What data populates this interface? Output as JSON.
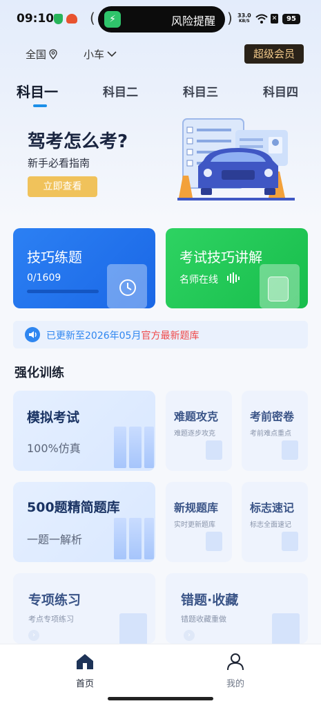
{
  "status_bar": {
    "time": "09:10",
    "island_text": "风险提醒",
    "net_speed_value": "33.0",
    "net_speed_unit": "KB/S",
    "battery": "95"
  },
  "header": {
    "location": "全国",
    "car_type": "小车",
    "vip_label": "超级会员"
  },
  "tabs": [
    {
      "label": "科目一",
      "active": true
    },
    {
      "label": "科目二",
      "active": false
    },
    {
      "label": "科目三",
      "active": false
    },
    {
      "label": "科目四",
      "active": false
    }
  ],
  "banner": {
    "title": "驾考怎么考?",
    "subtitle": "新手必看指南",
    "button": "立即查看"
  },
  "practice_card": {
    "title": "技巧练题",
    "progress_text": "0/1609",
    "progress_fraction": 0
  },
  "lecture_card": {
    "title": "考试技巧讲解",
    "subtitle": "名师在线"
  },
  "notice": {
    "text": "已更新至2026年05月",
    "highlight": "官方最新题库"
  },
  "section": {
    "title": "强化训练"
  },
  "training": {
    "mock_exam": {
      "title": "模拟考试",
      "subtitle": "100%仿真"
    },
    "hard_questions": {
      "title": "难题攻克",
      "subtitle": "难题逐步攻克"
    },
    "pre_exam_paper": {
      "title": "考前密卷",
      "subtitle": "考前难点重点"
    },
    "bank_500": {
      "title": "500题精简题库",
      "subtitle": "一题一解析"
    },
    "new_rules": {
      "title": "新规题库",
      "subtitle": "实时更新题库"
    },
    "signs": {
      "title": "标志速记",
      "subtitle": "标志全面速记"
    },
    "special": {
      "title": "专项练习",
      "subtitle": "考点专项练习"
    },
    "mistakes": {
      "title": "错题·收藏",
      "subtitle": "错题收藏重做"
    }
  },
  "bottom_nav": {
    "home": "首页",
    "me": "我的"
  },
  "colors": {
    "accent_blue": "#1a67e6",
    "accent_green": "#18bd4c",
    "notice_red": "#f04a4a",
    "vip_gold": "#f2c98a"
  }
}
